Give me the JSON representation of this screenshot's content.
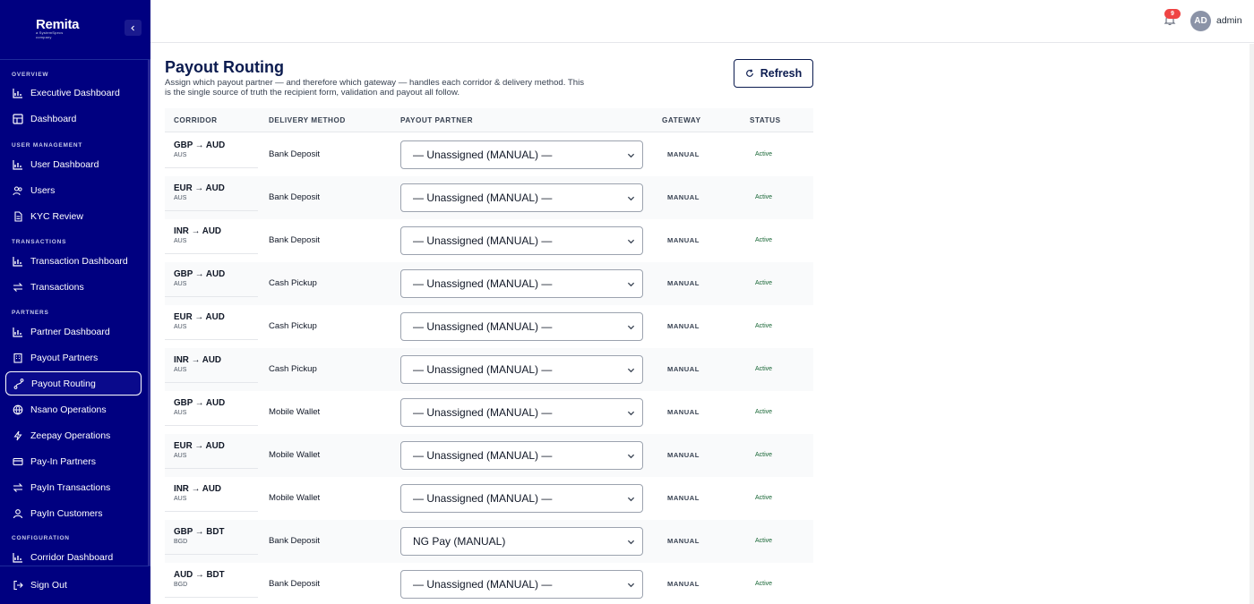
{
  "app": {
    "logo_text": "Remita",
    "logo_sub": "a SystemSpecs company"
  },
  "header": {
    "notification_count": "9",
    "avatar_initials": "AD",
    "user_name": "admin"
  },
  "sidebar": {
    "sections": {
      "overview": "Overview",
      "user_management": "User Management",
      "transactions": "Transactions",
      "partners": "Partners",
      "configuration": "Configuration"
    },
    "items": [
      {
        "label": "Executive Dashboard",
        "icon": "chart-icon"
      },
      {
        "label": "Dashboard",
        "icon": "grid-icon"
      },
      {
        "label": "User Dashboard",
        "icon": "chart-icon"
      },
      {
        "label": "Users",
        "icon": "users-icon"
      },
      {
        "label": "KYC Review",
        "icon": "document-icon"
      },
      {
        "label": "Transaction Dashboard",
        "icon": "chart-icon"
      },
      {
        "label": "Transactions",
        "icon": "arrows-icon"
      },
      {
        "label": "Partner Dashboard",
        "icon": "chart-icon"
      },
      {
        "label": "Payout Partners",
        "icon": "building-icon"
      },
      {
        "label": "Payout Routing",
        "icon": "route-icon"
      },
      {
        "label": "Nsano Operations",
        "icon": "globe-icon"
      },
      {
        "label": "Zeepay Operations",
        "icon": "bolt-icon"
      },
      {
        "label": "Pay-In Partners",
        "icon": "card-icon"
      },
      {
        "label": "PayIn Transactions",
        "icon": "arrows-icon"
      },
      {
        "label": "PayIn Customers",
        "icon": "user-icon"
      },
      {
        "label": "Corridor Dashboard",
        "icon": "chart-icon"
      }
    ],
    "active_item": "Payout Routing",
    "sign_out": "Sign Out"
  },
  "page": {
    "title": "Payout Routing",
    "description": "Assign which payout partner — and therefore which gateway — handles each corridor & delivery method. This is the single source of truth the recipient form, validation and payout all follow.",
    "refresh_label": "Refresh"
  },
  "table": {
    "headers": {
      "corridor": "Corridor",
      "delivery_method": "Delivery Method",
      "payout_partner": "Payout Partner",
      "gateway": "Gateway",
      "status": "Status"
    },
    "rows": [
      {
        "corridor": "GBP → AUD",
        "country": "AUS",
        "method": "Bank Deposit",
        "partner": "— Unassigned (MANUAL) —",
        "gateway": "MANUAL",
        "status": "Active"
      },
      {
        "corridor": "EUR → AUD",
        "country": "AUS",
        "method": "Bank Deposit",
        "partner": "— Unassigned (MANUAL) —",
        "gateway": "MANUAL",
        "status": "Active"
      },
      {
        "corridor": "INR → AUD",
        "country": "AUS",
        "method": "Bank Deposit",
        "partner": "— Unassigned (MANUAL) —",
        "gateway": "MANUAL",
        "status": "Active"
      },
      {
        "corridor": "GBP → AUD",
        "country": "AUS",
        "method": "Cash Pickup",
        "partner": "— Unassigned (MANUAL) —",
        "gateway": "MANUAL",
        "status": "Active"
      },
      {
        "corridor": "EUR → AUD",
        "country": "AUS",
        "method": "Cash Pickup",
        "partner": "— Unassigned (MANUAL) —",
        "gateway": "MANUAL",
        "status": "Active"
      },
      {
        "corridor": "INR → AUD",
        "country": "AUS",
        "method": "Cash Pickup",
        "partner": "— Unassigned (MANUAL) —",
        "gateway": "MANUAL",
        "status": "Active"
      },
      {
        "corridor": "GBP → AUD",
        "country": "AUS",
        "method": "Mobile Wallet",
        "partner": "— Unassigned (MANUAL) —",
        "gateway": "MANUAL",
        "status": "Active"
      },
      {
        "corridor": "EUR → AUD",
        "country": "AUS",
        "method": "Mobile Wallet",
        "partner": "— Unassigned (MANUAL) —",
        "gateway": "MANUAL",
        "status": "Active"
      },
      {
        "corridor": "INR → AUD",
        "country": "AUS",
        "method": "Mobile Wallet",
        "partner": "— Unassigned (MANUAL) —",
        "gateway": "MANUAL",
        "status": "Active"
      },
      {
        "corridor": "GBP → BDT",
        "country": "BGD",
        "method": "Bank Deposit",
        "partner": "NG Pay (MANUAL)",
        "gateway": "MANUAL",
        "status": "Active"
      },
      {
        "corridor": "AUD → BDT",
        "country": "BGD",
        "method": "Bank Deposit",
        "partner": "— Unassigned (MANUAL) —",
        "gateway": "MANUAL",
        "status": "Active"
      }
    ]
  },
  "colors": {
    "sidebar_bg": "#000080",
    "title_color": "#0b1b4f",
    "status_active": "#166534"
  }
}
